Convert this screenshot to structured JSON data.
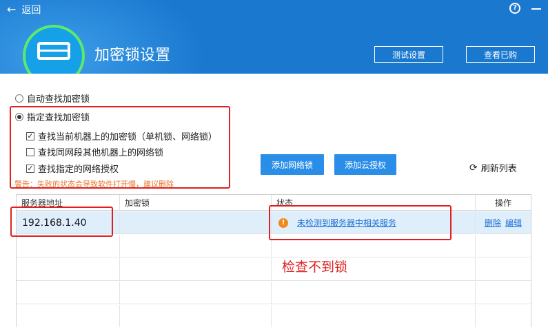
{
  "header": {
    "back_label": "返回",
    "title": "加密锁设置",
    "test_settings_button": "测试设置",
    "view_purchased_button": "查看已购"
  },
  "icons": {
    "back": "arrow-left-icon",
    "help": "help-circle-icon",
    "minimize": "minimize-icon",
    "logo": "dongle-device-icon",
    "warning": "warning-circle-icon",
    "refresh": "refresh-icon"
  },
  "options": {
    "auto_find": "自动查找加密锁",
    "specify_find": "指定查找加密锁",
    "selected_mode": "specify_find",
    "sub": [
      {
        "label": "查找当前机器上的加密锁（单机锁、网络锁）",
        "checked": true
      },
      {
        "label": "查找同网段其他机器上的网络锁",
        "checked": false
      },
      {
        "label": "查找指定的网络授权",
        "checked": true
      }
    ],
    "warning": "警告：失败的状态会导致软件打开慢，建议删除"
  },
  "actions": {
    "add_network_lock": "添加网络锁",
    "add_cloud_auth": "添加云授权",
    "refresh_list": "刷新列表"
  },
  "table": {
    "headers": [
      "服务器地址",
      "加密锁",
      "状态",
      "操作"
    ],
    "rows": [
      {
        "server": "192.168.1.40",
        "lock": "",
        "status": "未检测到服务器中相关服务",
        "op_delete": "删除",
        "op_edit": "编辑"
      }
    ]
  },
  "annotation": "检查不到锁",
  "colors": {
    "header_bg": "#1a78cf",
    "button_blue": "#2a8ee8",
    "highlight_red": "#e02020",
    "warning_orange": "#f08a1a",
    "link_blue": "#1a6fd4",
    "logo_ring_green": "#5ee86e"
  }
}
